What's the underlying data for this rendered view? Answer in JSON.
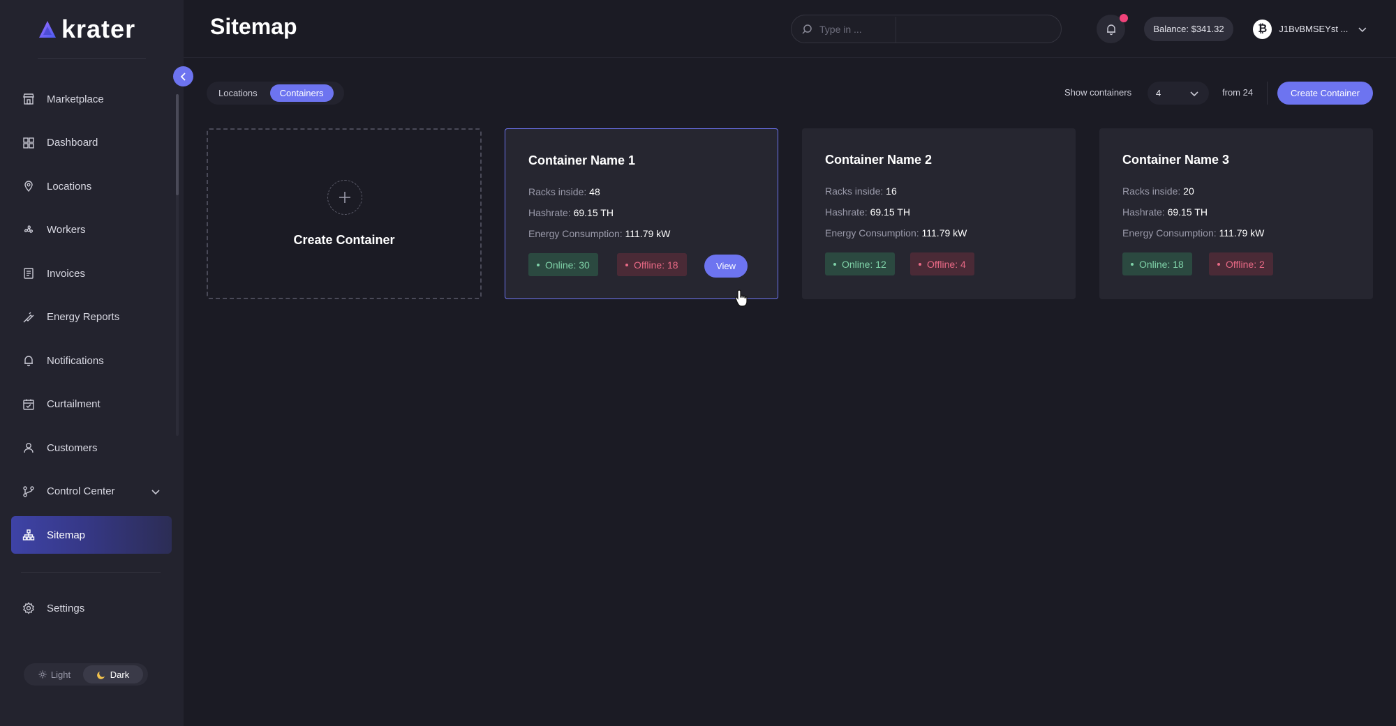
{
  "app": {
    "logo_text": "krater"
  },
  "sidebar": {
    "items": [
      {
        "label": "Marketplace",
        "icon": "store-icon"
      },
      {
        "label": "Dashboard",
        "icon": "dashboard-grid-icon"
      },
      {
        "label": "Locations",
        "icon": "location-pin-icon"
      },
      {
        "label": "Workers",
        "icon": "fan-icon"
      },
      {
        "label": "Invoices",
        "icon": "invoice-icon"
      },
      {
        "label": "Energy Reports",
        "icon": "plug-icon"
      },
      {
        "label": "Notifications",
        "icon": "bell-icon"
      },
      {
        "label": "Curtailment",
        "icon": "calendar-icon"
      },
      {
        "label": "Customers",
        "icon": "user-icon"
      },
      {
        "label": "Control Center",
        "icon": "branch-icon"
      },
      {
        "label": "Sitemap",
        "icon": "sitemap-icon"
      }
    ],
    "active": "Sitemap",
    "settings_label": "Settings",
    "theme": {
      "light": "Light",
      "dark": "Dark",
      "selected": "Dark"
    }
  },
  "header": {
    "title": "Sitemap",
    "search_placeholder": "Type in ...",
    "balance": "Balance: $341.32",
    "account_id": "J1BvBMSEYst ...",
    "accent_color": "#6d74f0",
    "notification_dot_color": "#f0437a"
  },
  "toolbar": {
    "tabs": [
      "Locations",
      "Containers"
    ],
    "active_tab": "Containers",
    "show_label": "Show containers",
    "show_value": "4",
    "from_label": "from 24",
    "create_button": "Create Container"
  },
  "create_card": {
    "label": "Create Container"
  },
  "containers": [
    {
      "name": "Container Name 1",
      "racks_label": "Racks inside:",
      "racks": "48",
      "hashrate_label": "Hashrate:",
      "hashrate": "69.15 TH",
      "energy_label": "Energy Consumption:",
      "energy": "111.79 kW",
      "online": "Online: 30",
      "offline": "Offline: 18",
      "view_label": "View"
    },
    {
      "name": "Container Name 2",
      "racks_label": "Racks inside:",
      "racks": "16",
      "hashrate_label": "Hashrate:",
      "hashrate": "69.15 TH",
      "energy_label": "Energy Consumption:",
      "energy": "111.79 kW",
      "online": "Online: 12",
      "offline": "Offline: 4"
    },
    {
      "name": "Container Name 3",
      "racks_label": "Racks inside:",
      "racks": "20",
      "hashrate_label": "Hashrate:",
      "hashrate": "69.15 TH",
      "energy_label": "Energy Consumption:",
      "energy": "111.79 kW",
      "online": "Online: 18",
      "offline": "Offline: 2"
    }
  ]
}
